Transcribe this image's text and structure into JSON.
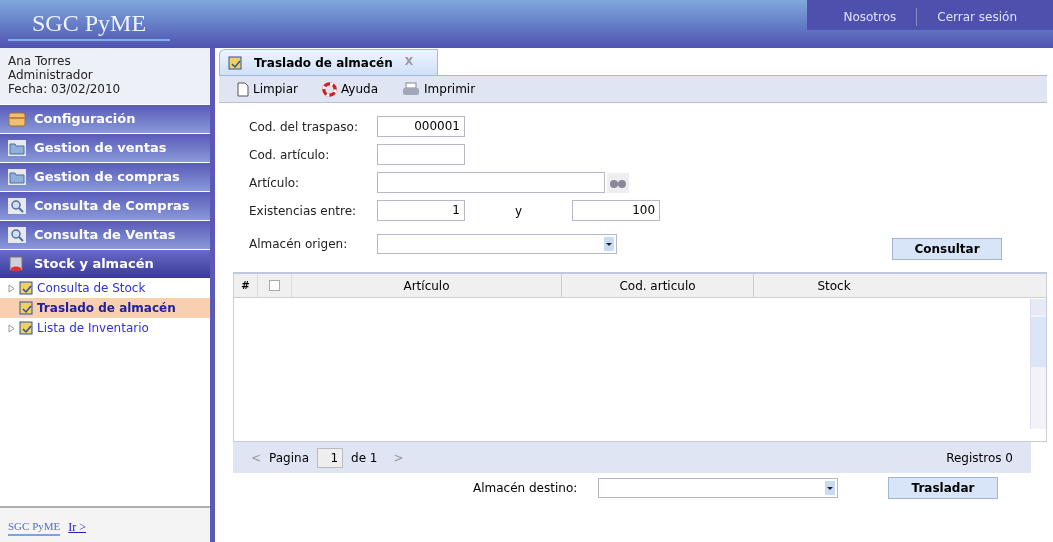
{
  "header": {
    "logo": "SGC PyME",
    "links": [
      "Nosotros",
      "Cerrar sesión"
    ]
  },
  "user": {
    "name": "Ana Torres",
    "role": "Administrador",
    "date": "Fecha: 03/02/2010"
  },
  "menu": [
    {
      "label": "Configuración",
      "expanded": false
    },
    {
      "label": "Gestion de ventas",
      "expanded": false
    },
    {
      "label": "Gestion de compras",
      "expanded": false
    },
    {
      "label": "Consulta de Compras",
      "expanded": false
    },
    {
      "label": "Consulta de Ventas",
      "expanded": false
    },
    {
      "label": "Stock y almacén",
      "expanded": true,
      "children": [
        {
          "label": "Consulta de Stock",
          "selected": false,
          "expandable": true
        },
        {
          "label": "Traslado de almacén",
          "selected": true,
          "expandable": false
        },
        {
          "label": "Lista de Inventario",
          "selected": false,
          "expandable": true
        }
      ]
    }
  ],
  "sidebar_footer": {
    "logo": "SGC PyME",
    "link": "Ir >"
  },
  "tab": {
    "title": "Traslado de almacén",
    "close": "X"
  },
  "toolbar": [
    "Limpiar",
    "Ayuda",
    "Imprimir"
  ],
  "form": {
    "transfer_code": {
      "label": "Cod. del traspaso:",
      "value": "000001"
    },
    "item_code": {
      "label": "Cod. artículo:"
    },
    "item": {
      "label": "Artículo:"
    },
    "stock_range": {
      "label": "Existencias entre:",
      "from": "1",
      "and": "y",
      "to": "100"
    },
    "origin": {
      "label": "Almacén origen:"
    },
    "query_button": "Consultar"
  },
  "table": {
    "columns": [
      "#",
      "Artículo",
      "Cod. articulo",
      "Stock"
    ],
    "select_all_checked": false
  },
  "pager": {
    "prev": "<",
    "page_label": "Pagina",
    "page": "1",
    "of": "de 1",
    "next": ">",
    "records": "Registros 0"
  },
  "destination": {
    "label": "Almacén destino:",
    "button": "Trasladar"
  }
}
